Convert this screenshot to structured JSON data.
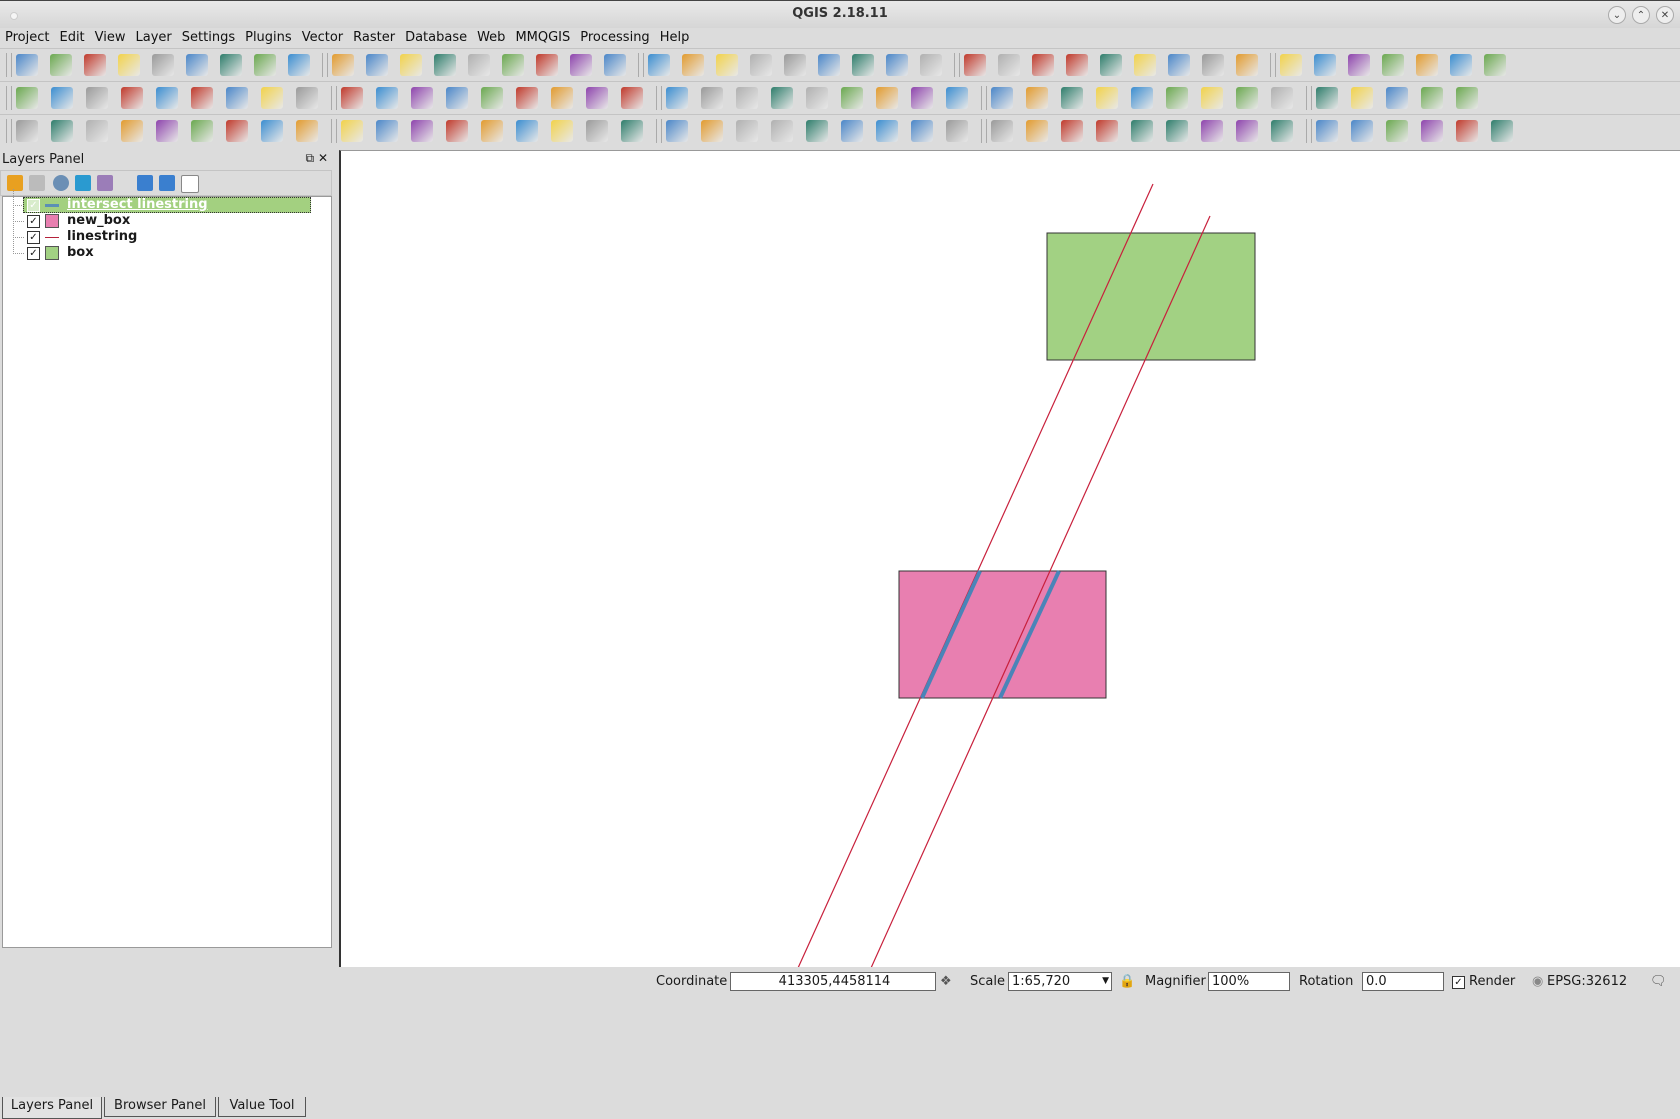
{
  "window": {
    "title": "QGIS 2.18.11"
  },
  "menu": [
    "Project",
    "Edit",
    "View",
    "Layer",
    "Settings",
    "Plugins",
    "Vector",
    "Raster",
    "Database",
    "Web",
    "MMQGIS",
    "Processing",
    "Help"
  ],
  "layers_panel": {
    "title": "Layers Panel",
    "layers": [
      {
        "name": "intersect linestring",
        "checked": true,
        "symbol": "line",
        "color": "#5b8fb5",
        "selected": true
      },
      {
        "name": "new_box",
        "checked": true,
        "symbol": "fill",
        "color": "#e87fb0",
        "selected": false
      },
      {
        "name": "linestring",
        "checked": true,
        "symbol": "line",
        "color": "#b5213a",
        "selected": false
      },
      {
        "name": "box",
        "checked": true,
        "symbol": "fill",
        "color": "#a2d183",
        "selected": false
      }
    ],
    "tabs": [
      "Layers Panel",
      "Browser Panel",
      "Value Tool"
    ],
    "active_tab": "Layers Panel"
  },
  "map": {
    "box_color": "#a2d183",
    "new_box_color": "#e87fb0",
    "linestring_color": "#c8203c",
    "intersect_color": "#4a84b8"
  },
  "status": {
    "coordinate_label": "Coordinate",
    "coordinate_value": "413305,4458114",
    "scale_label": "Scale",
    "scale_value": "1:65,720",
    "magnifier_label": "Magnifier",
    "magnifier_value": "100%",
    "rotation_label": "Rotation",
    "rotation_value": "0.0",
    "render_label": "Render",
    "render_checked": true,
    "crs": "EPSG:32612"
  },
  "toolbars": {
    "row1": [
      "new-project",
      "open-project",
      "save-project",
      "save-as",
      "new-print-composer",
      "composer-manager",
      "pan",
      "pan-to-selection",
      "zoom-in",
      "zoom-out",
      "zoom-native",
      "zoom-full",
      "zoom-to-selection",
      "zoom-to-layer",
      "zoom-last",
      "zoom-next",
      "new-bookmark",
      "show-bookmarks",
      "refresh",
      "identify",
      "run-action",
      "select-features",
      "select-by-expression",
      "deselect",
      "attribute-table",
      "field-calculator",
      "statistics",
      "measure",
      "map-tips",
      "text-annotation",
      "help",
      "profile1",
      "profile2",
      "profile3",
      "profile4",
      "hillshade-up",
      "hillshade-down",
      "shade-up",
      "shade-down",
      "grid",
      "heatmap",
      "point-sampling",
      "zonal-stats"
    ],
    "row2": [
      "current-edits",
      "toggle-editing",
      "save-edits",
      "add-feature",
      "vertex-tool",
      "node-tool",
      "delete-selected",
      "cut",
      "copy",
      "paste",
      "label",
      "diagram",
      "label-pin",
      "label-show",
      "label-move",
      "label-rotate",
      "label-change",
      "add-wms",
      "add-wcs",
      "csw",
      "python",
      "plugin-a",
      "plugin-builder",
      "annotation",
      "identify-plus",
      "wkt",
      "undo-redo",
      "area",
      "wkt-layer",
      "add-vector",
      "add-raster",
      "add-spatialite",
      "add-postgis",
      "add-wfs",
      "add-mssql",
      "add-virtual",
      "add-delimited",
      "add-layer-def",
      "gps",
      "gps2",
      "sun"
    ],
    "row3": [
      "measure-tool",
      "snapping",
      "undo",
      "redo",
      "rotate-feature",
      "simplify",
      "add-ring",
      "add-part",
      "fill-ring",
      "delete-ring",
      "delete-part",
      "reshape",
      "offset-curve",
      "split-features",
      "split-parts",
      "merge",
      "merge-attributes",
      "rotate-point",
      "geoprocessing",
      "settings",
      "search",
      "hydro",
      "pollute",
      "wormhole",
      "grid-plugin",
      "points",
      "spiral",
      "gears",
      "satellite",
      "sound",
      "wave",
      "long-lat",
      "distort",
      "mouse",
      "flag",
      "plug",
      "tools",
      "more",
      "chest",
      "lightning",
      "heat",
      "mountain"
    ]
  }
}
